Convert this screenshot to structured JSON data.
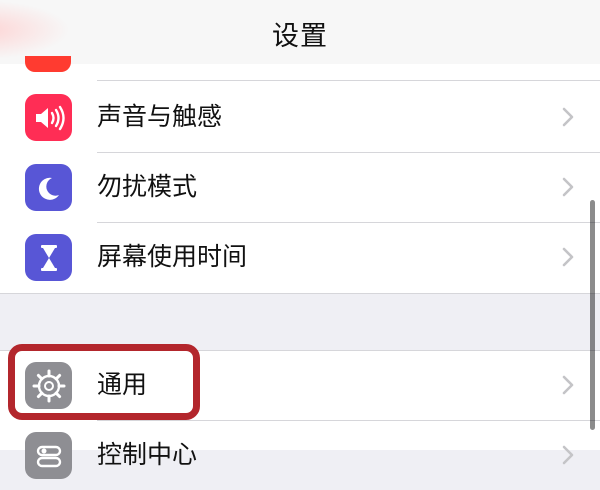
{
  "nav": {
    "title": "设置"
  },
  "colors": {
    "sound_icon_bg": "#ff2d55",
    "dnd_icon_bg": "#5856d6",
    "screen_time_icon_bg": "#5856d6",
    "general_icon_bg": "#8e8e93",
    "control_center_icon_bg": "#8e8e93",
    "highlight": "#b3262c"
  },
  "group1": {
    "items": [
      {
        "label": "声音与触感",
        "icon": "speaker-icon"
      },
      {
        "label": "勿扰模式",
        "icon": "moon-icon"
      },
      {
        "label": "屏幕使用时间",
        "icon": "hourglass-icon"
      }
    ]
  },
  "group2": {
    "items": [
      {
        "label": "通用",
        "icon": "gear-icon"
      },
      {
        "label": "控制中心",
        "icon": "control-center-icon"
      }
    ]
  }
}
